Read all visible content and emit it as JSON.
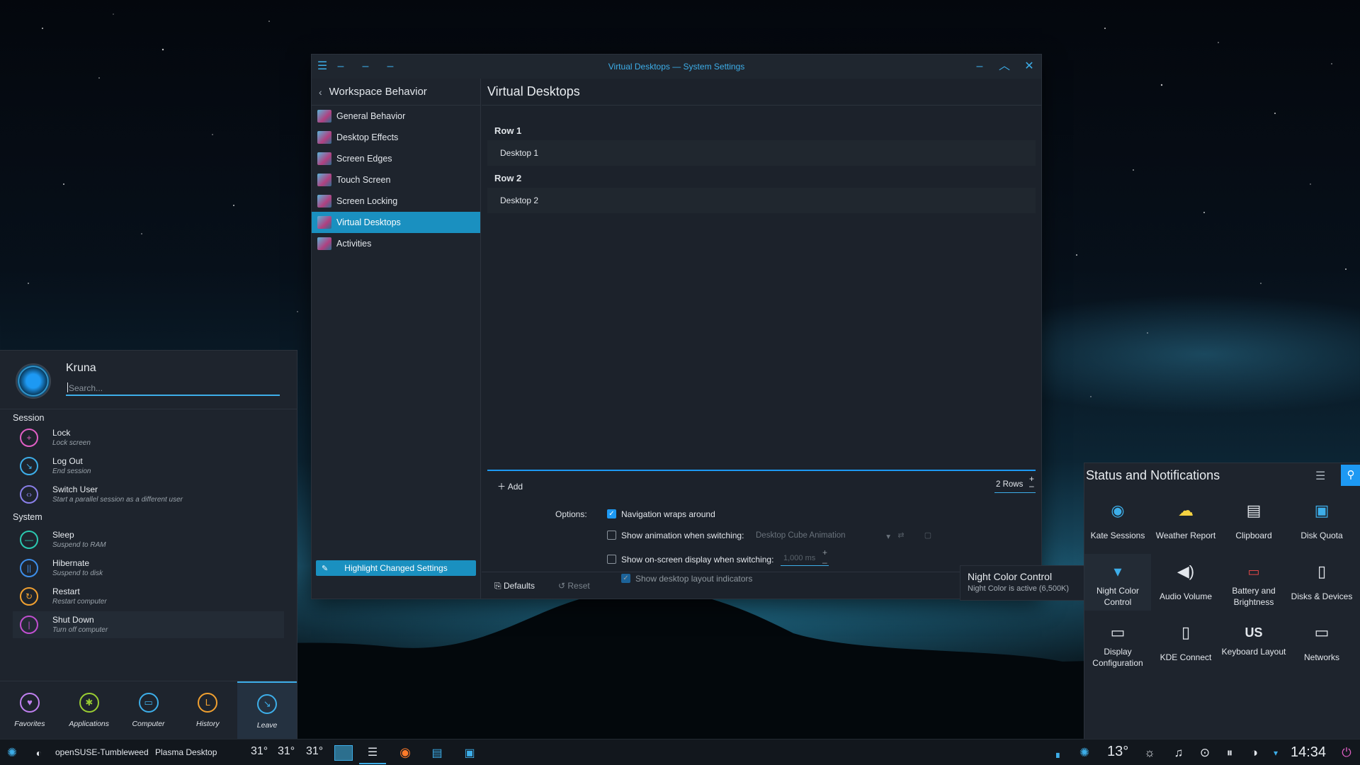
{
  "window": {
    "title": "Virtual Desktops — System Settings",
    "sidebar": {
      "header": "Workspace Behavior",
      "items": [
        {
          "label": "General Behavior",
          "selected": false
        },
        {
          "label": "Desktop Effects",
          "selected": false
        },
        {
          "label": "Screen Edges",
          "selected": false
        },
        {
          "label": "Touch Screen",
          "selected": false
        },
        {
          "label": "Screen Locking",
          "selected": false
        },
        {
          "label": "Virtual Desktops",
          "selected": true
        },
        {
          "label": "Activities",
          "selected": false
        }
      ],
      "highlight_button": "Highlight Changed Settings"
    },
    "content": {
      "title": "Virtual Desktops",
      "rows": [
        {
          "label": "Row 1",
          "desktop": "Desktop 1"
        },
        {
          "label": "Row 2",
          "desktop": "Desktop 2"
        }
      ],
      "add_label": "Add",
      "rows_value": "2 Rows",
      "options_label": "Options:",
      "options": [
        {
          "label": "Navigation wraps around",
          "checked": true
        },
        {
          "label": "Show animation when switching:",
          "checked": false,
          "combo": "Desktop Cube Animation"
        },
        {
          "label": "Show on-screen display when switching:",
          "checked": false,
          "duration": "1,000 ms"
        },
        {
          "label": "Show desktop layout indicators",
          "checked": true,
          "disabled": true
        }
      ],
      "defaults_label": "Defaults",
      "reset_label": "Reset"
    }
  },
  "tooltip": {
    "title": "Night Color Control",
    "subtitle": "Night Color is active (6,500K)"
  },
  "launcher": {
    "user": "Kruna",
    "search_placeholder": "Search...",
    "session_header": "Session",
    "session": [
      {
        "name": "Lock",
        "desc": "Lock screen",
        "icon": "lock-icon",
        "color": "#e05fc4"
      },
      {
        "name": "Log Out",
        "desc": "End session",
        "icon": "logout-icon",
        "color": "#3daee9"
      },
      {
        "name": "Switch User",
        "desc": "Start a parallel session as a different user",
        "icon": "switch-user-icon",
        "color": "#8a7fe8"
      }
    ],
    "system_header": "System",
    "system": [
      {
        "name": "Sleep",
        "desc": "Suspend to RAM",
        "icon": "sleep-icon",
        "color": "#2bc8b0"
      },
      {
        "name": "Hibernate",
        "desc": "Suspend to disk",
        "icon": "hibernate-icon",
        "color": "#3d8ee9"
      },
      {
        "name": "Restart",
        "desc": "Restart computer",
        "icon": "restart-icon",
        "color": "#f0a030"
      },
      {
        "name": "Shut Down",
        "desc": "Turn off computer",
        "icon": "shutdown-icon",
        "color": "#c04fd0"
      }
    ],
    "tabs": [
      {
        "label": "Favorites",
        "icon": "heart-icon",
        "color": "#c080f0"
      },
      {
        "label": "Applications",
        "icon": "applications-icon",
        "color": "#9acd32"
      },
      {
        "label": "Computer",
        "icon": "computer-icon",
        "color": "#3daee9"
      },
      {
        "label": "History",
        "icon": "history-icon",
        "color": "#f0a030"
      },
      {
        "label": "Leave",
        "icon": "leave-icon",
        "color": "#3daee9",
        "selected": true
      }
    ]
  },
  "tray": {
    "title": "Status and Notifications",
    "items": [
      {
        "label": "Kate Sessions",
        "icon": "kate-icon"
      },
      {
        "label": "Weather Report",
        "icon": "weather-icon"
      },
      {
        "label": "Clipboard",
        "icon": "clipboard-icon"
      },
      {
        "label": "Disk Quota",
        "icon": "disk-quota-icon"
      },
      {
        "label": "Night Color Control",
        "icon": "night-color-icon",
        "selected": true
      },
      {
        "label": "Audio Volume",
        "icon": "audio-volume-icon"
      },
      {
        "label": "Battery and Brightness",
        "icon": "battery-icon"
      },
      {
        "label": "Disks & Devices",
        "icon": "disks-devices-icon"
      },
      {
        "label": "Display Configuration",
        "icon": "display-config-icon"
      },
      {
        "label": "KDE Connect",
        "icon": "kde-connect-icon"
      },
      {
        "label": "Keyboard Layout",
        "icon": "keyboard-layout-icon",
        "glyph": "US"
      },
      {
        "label": "Networks",
        "icon": "networks-icon"
      }
    ]
  },
  "panel": {
    "distro": "openSUSE-Tumbleweed",
    "session": "Plasma Desktop",
    "temps": [
      "31°",
      "31°",
      "31°"
    ],
    "weather_temp": "13°",
    "clock": "14:34"
  },
  "colors": {
    "accent": "#3daee9",
    "selection": "#1a90c0",
    "window_bg": "#1c222b",
    "panel_bg": "#12171d"
  }
}
